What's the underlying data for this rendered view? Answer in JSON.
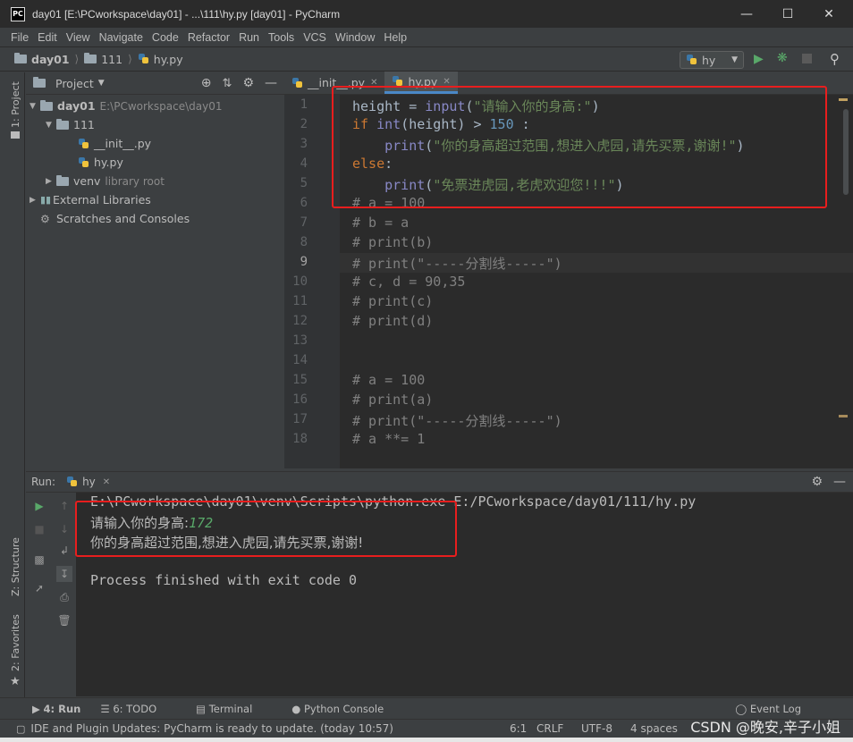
{
  "window": {
    "title": "day01 [E:\\PCworkspace\\day01] - ...\\111\\hy.py [day01] - PyCharm",
    "app_icon": "PC"
  },
  "menu": [
    "File",
    "Edit",
    "View",
    "Navigate",
    "Code",
    "Refactor",
    "Run",
    "Tools",
    "VCS",
    "Window",
    "Help"
  ],
  "breadcrumb": [
    "day01",
    "111",
    "hy.py"
  ],
  "run_config": {
    "name": "hy"
  },
  "project": {
    "header": "Project",
    "tree": [
      {
        "label": "day01",
        "extra": "E:\\PCworkspace\\day01"
      },
      {
        "label": "111",
        "extra": ""
      },
      {
        "label": "__init__.py",
        "extra": ""
      },
      {
        "label": "hy.py",
        "extra": ""
      },
      {
        "label": "venv",
        "extra": "library root"
      },
      {
        "label": "External Libraries",
        "extra": ""
      },
      {
        "label": "Scratches and Consoles",
        "extra": ""
      }
    ]
  },
  "side_tabs": {
    "project": "1: Project",
    "structure": "Z: Structure",
    "favorites": "2: Favorites"
  },
  "editor": {
    "tabs": [
      "__init__.py",
      "hy.py"
    ],
    "line_numbers": [
      "1",
      "2",
      "3",
      "4",
      "5",
      "6",
      "7",
      "8",
      "9",
      "10",
      "11",
      "12",
      "13",
      "14",
      "15",
      "16",
      "17",
      "18"
    ],
    "current_line": "9",
    "code": {
      "l1_a": "height = ",
      "l1_b": "input",
      "l1_c": "(",
      "l1_d": "\"请输入你的身高:\"",
      "l1_e": ")",
      "l2_a": "if ",
      "l2_b": "int",
      "l2_c": "(height) > ",
      "l2_d": "150",
      "l2_e": " :",
      "l3_a": "    ",
      "l3_b": "print",
      "l3_c": "(",
      "l3_d": "\"你的身高超过范围,想进入虎园,请先买票,谢谢!\"",
      "l3_e": ")",
      "l4_a": "else",
      "l4_b": ":",
      "l5_a": "    ",
      "l5_b": "print",
      "l5_c": "(",
      "l5_d": "\"免票进虎园,老虎欢迎您!!!\"",
      "l5_e": ")",
      "l6": "# a = 100",
      "l7": "# b = a",
      "l8": "# print(b)",
      "l9": "# print(\"-----分割线-----\")",
      "l10": "# c, d = 90,35",
      "l11": "# print(c)",
      "l12": "# print(d)",
      "l15": "# a = 100",
      "l16": "# print(a)",
      "l17": "# print(\"-----分割线-----\")",
      "l18": "# a **= 1"
    }
  },
  "run_panel": {
    "label": "Run:",
    "tab": "hy",
    "output": {
      "cmd": "E:\\PCworkspace\\day01\\venv\\Scripts\\python.exe E:/PCworkspace/day01/111/hy.py",
      "prompt": "请输入你的身高:",
      "input_value": "172",
      "result": "你的身高超过范围,想进入虎园,请先买票,谢谢!",
      "exit": "Process finished with exit code 0"
    }
  },
  "bottom_tabs": [
    "4: Run",
    "6: TODO",
    "Terminal",
    "Python Console"
  ],
  "event_log": "Event Log",
  "status": {
    "message": "IDE and Plugin Updates: PyCharm is ready to update. (today 10:57)",
    "position": "6:1",
    "line_sep": "CRLF",
    "encoding": "UTF-8",
    "indent": "4 spaces"
  },
  "watermark": "CSDN @晚安,辛子小姐",
  "colors": {
    "highlight_box": "#e81e1e",
    "keyword": "#cc7832",
    "string": "#6a8759",
    "number": "#6897bb",
    "comment": "#808080"
  }
}
